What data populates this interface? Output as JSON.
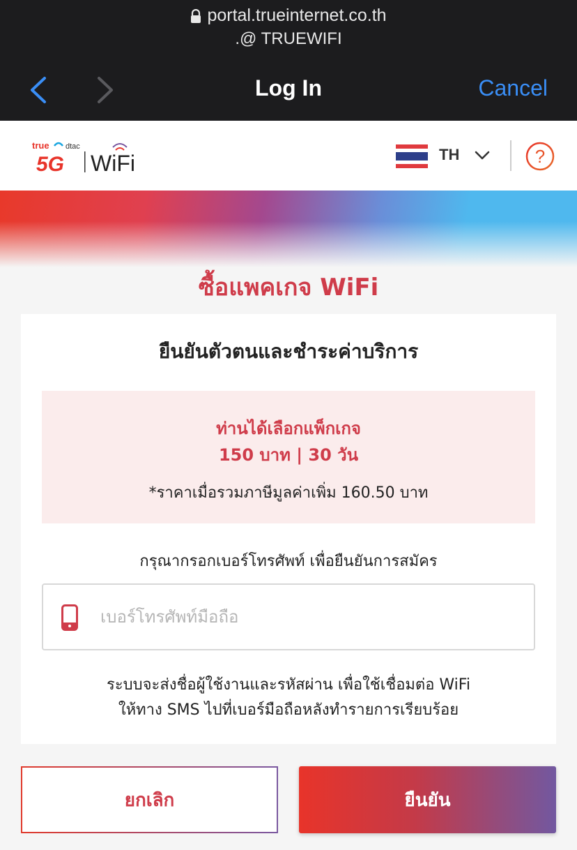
{
  "browser": {
    "url": "portal.trueinternet.co.th",
    "network": ".@ TRUEWIFI",
    "title": "Log In",
    "cancel_label": "Cancel"
  },
  "header": {
    "logo_brand": "true",
    "logo_partner": "dtac",
    "logo_5g": "5G",
    "logo_wifi": "WiFi",
    "language": "TH",
    "help_symbol": "?"
  },
  "page": {
    "title": "ซื้อแพคเกจ WiFi",
    "card_title": "ยืนยันตัวตนและชำระค่าบริการ",
    "package": {
      "heading": "ท่านได้เลือกแพ็กเกจ",
      "detail": "150 บาท | 30 วัน",
      "note": "*ราคาเมื่อรวมภาษีมูลค่าเพิ่ม 160.50 บาท"
    },
    "instruction": "กรุณากรอกเบอร์โทรศัพท์ เพื่อยืนยันการสมัคร",
    "phone_placeholder": "เบอร์โทรศัพท์มือถือ",
    "sms_note_line1": "ระบบจะส่งชื่อผู้ใช้งานและรหัสผ่าน เพื่อใช้เชื่อมต่อ WiFi",
    "sms_note_line2": "ให้ทาง SMS ไปที่เบอร์มือถือหลังทำรายการเรียบร้อย"
  },
  "actions": {
    "cancel_label": "ยกเลิก",
    "confirm_label": "ยืนยัน"
  },
  "colors": {
    "accent_red": "#cf3c4a",
    "link_blue": "#3a8ef6",
    "gradient_start": "#e8342a",
    "gradient_end": "#7258a0"
  }
}
